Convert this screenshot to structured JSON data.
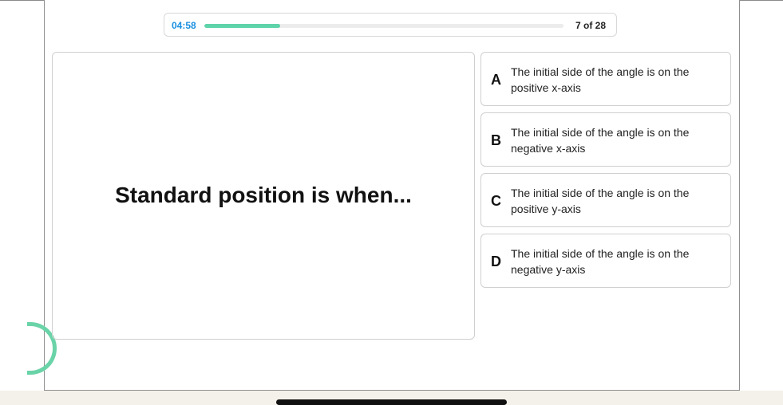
{
  "quiz": {
    "timer": "04:58",
    "progress": 0.21,
    "counter": "7 of 28"
  },
  "question": {
    "text": "Standard position is when..."
  },
  "options": [
    {
      "letter": "A",
      "text": "The initial side of the angle is on the positive x-axis"
    },
    {
      "letter": "B",
      "text": "The initial side of the angle is on the negative x-axis"
    },
    {
      "letter": "C",
      "text": "The initial side of the angle is on the positive y-axis"
    },
    {
      "letter": "D",
      "text": "The initial side of the angle is on the negative y-axis"
    }
  ],
  "colors": {
    "accent": "#1a8fe0",
    "progress": "#5fd3aa",
    "ring": "#6ad3a8"
  }
}
